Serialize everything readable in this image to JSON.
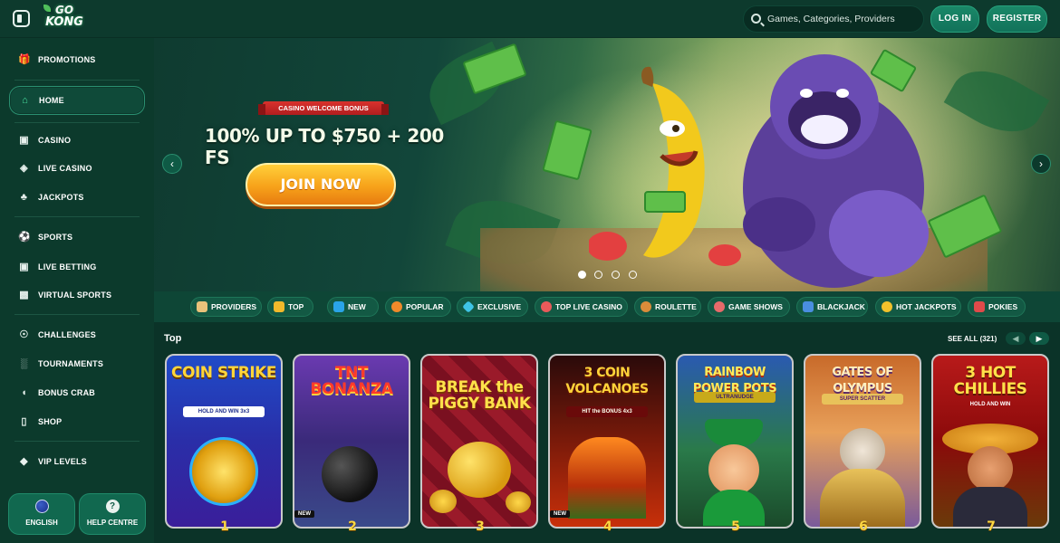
{
  "header": {
    "logo_line1": "GO",
    "logo_line2": "KONG",
    "search_placeholder": "Games, Categories, Providers",
    "login_label": "LOG IN",
    "register_label": "REGISTER"
  },
  "sidebar": {
    "items": [
      {
        "label": "PROMOTIONS",
        "icon": "gift-icon"
      },
      {
        "label": "HOME",
        "icon": "home-icon",
        "active": true
      },
      {
        "label": "CASINO",
        "icon": "slot-machine-icon"
      },
      {
        "label": "LIVE CASINO",
        "icon": "live-casino-icon"
      },
      {
        "label": "JACKPOTS",
        "icon": "clover-icon"
      },
      {
        "label": "SPORTS",
        "icon": "ball-icon"
      },
      {
        "label": "LIVE BETTING",
        "icon": "live-icon"
      },
      {
        "label": "VIRTUAL SPORTS",
        "icon": "virtual-sports-icon"
      },
      {
        "label": "CHALLENGES",
        "icon": "medal-icon"
      },
      {
        "label": "TOURNAMENTS",
        "icon": "podium-icon"
      },
      {
        "label": "BONUS CRAB",
        "icon": "crab-icon"
      },
      {
        "label": "SHOP",
        "icon": "cart-icon"
      },
      {
        "label": "VIP LEVELS",
        "icon": "diamond-icon"
      }
    ],
    "language_label": "ENGLISH",
    "help_label": "HELP CENTRE"
  },
  "hero": {
    "badge": "CASINO WELCOME BONUS",
    "title": "100% UP TO $750 + 200 FS",
    "cta": "JOIN NOW",
    "slides": 4,
    "active_slide": 1
  },
  "categories": [
    {
      "label": "PROVIDERS",
      "color": "#e8c27a"
    },
    {
      "label": "TOP",
      "color": "#f2b92b"
    },
    {
      "label": "NEW",
      "color": "#2aa4e8"
    },
    {
      "label": "POPULAR",
      "color": "#f08a2a"
    },
    {
      "label": "EXCLUSIVE",
      "color": "#3fc4e6"
    },
    {
      "label": "TOP LIVE CASINO",
      "color": "#e85a5a"
    },
    {
      "label": "ROULETTE",
      "color": "#d98c3a"
    },
    {
      "label": "GAME SHOWS",
      "color": "#e86a6a"
    },
    {
      "label": "BLACKJACK",
      "color": "#4a8ee0"
    },
    {
      "label": "HOT JACKPOTS",
      "color": "#f2c12b"
    },
    {
      "label": "POKIES",
      "color": "#e04a4a"
    }
  ],
  "games_section": {
    "title": "Top",
    "see_all": "SEE ALL (321)",
    "games": [
      {
        "name": "COIN STRIKE",
        "sub": "HOLD AND WIN 3x3",
        "rank": "1",
        "new": false
      },
      {
        "name": "TNT BONANZA",
        "sub": "",
        "rank": "2",
        "new": true
      },
      {
        "name": "BREAK the PIGGY BANK",
        "sub": "",
        "rank": "3",
        "new": false
      },
      {
        "name": "3 COIN VOLCANOES",
        "sub": "HIT the BONUS 4x3",
        "rank": "4",
        "new": true
      },
      {
        "name": "RAINBOW POWER POTS",
        "sub": "ULTRANUDGE",
        "rank": "5",
        "new": false
      },
      {
        "name": "GATES OF OLYMPUS",
        "sub": "SUPER SCATTER",
        "rank": "6",
        "new": false
      },
      {
        "name": "3 HOT CHILLIES",
        "sub": "HOLD AND WIN",
        "rank": "7",
        "new": false
      }
    ],
    "new_badge": "NEW"
  }
}
